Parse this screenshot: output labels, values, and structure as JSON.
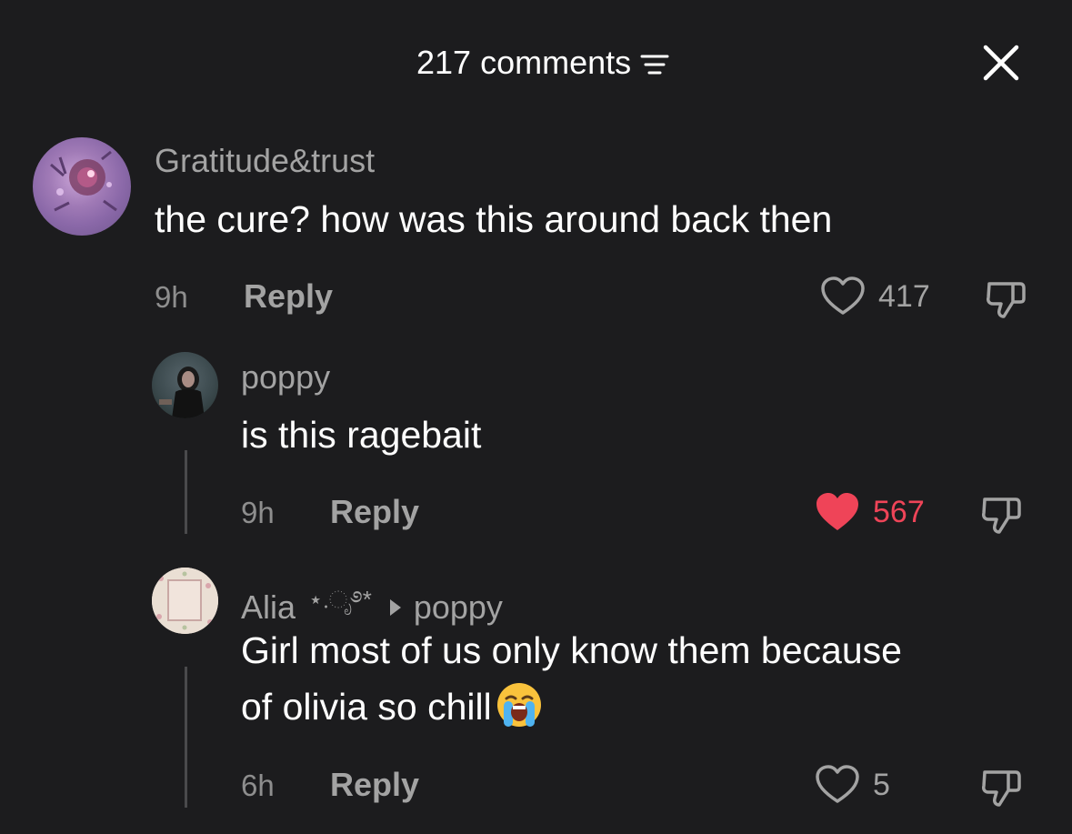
{
  "header": {
    "title": "217 comments",
    "sort_icon": "sort-icon",
    "close_icon": "close-icon"
  },
  "colors": {
    "background": "#1c1c1e",
    "text": "#ffffff",
    "muted": "#a3a3a3",
    "liked": "#ef4458"
  },
  "comments": [
    {
      "username": "Gratitude&trust",
      "text": "the cure? how was this around back then",
      "time": "9h",
      "reply_label": "Reply",
      "likes": "417",
      "liked": false
    },
    {
      "username": "poppy",
      "text": "is this ragebait",
      "time": "9h",
      "reply_label": "Reply",
      "likes": "567",
      "liked": true
    },
    {
      "username": "Alia",
      "username_decoration": "⋆.ೃ࿔*",
      "reply_to": "poppy",
      "text_line1": "Girl most of us only know them because",
      "text_line2": "of olivia so chill",
      "emoji": "loudly-crying-face",
      "time": "6h",
      "reply_label": "Reply",
      "likes": "5",
      "liked": false
    }
  ]
}
